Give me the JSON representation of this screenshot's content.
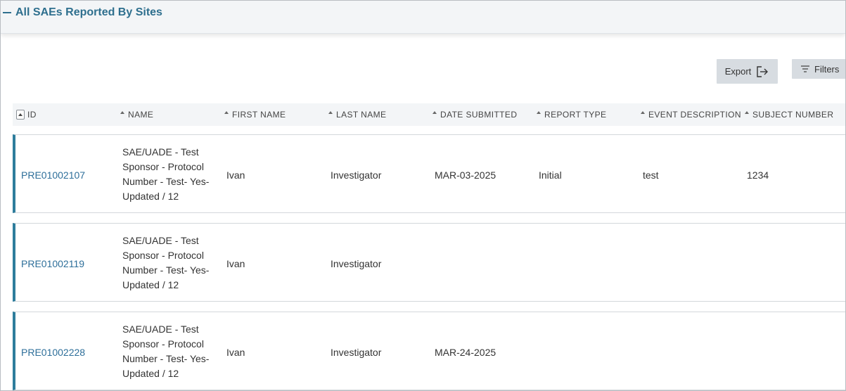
{
  "section": {
    "title": "All SAEs Reported By Sites"
  },
  "toolbar": {
    "export_label": "Export",
    "filters_label": "Filters"
  },
  "table": {
    "columns": [
      "ID",
      "NAME",
      "FIRST NAME",
      "LAST NAME",
      "DATE SUBMITTED",
      "REPORT TYPE",
      "EVENT DESCRIPTION",
      "SUBJECT NUMBER"
    ],
    "rows": [
      {
        "id": "PRE01002107",
        "name": "SAE/UADE - Test Sponsor - Protocol Number - Test- Yes- Updated / 12",
        "first_name": "Ivan",
        "last_name": "Investigator",
        "date_submitted": "MAR-03-2025",
        "report_type": "Initial",
        "event_description": "test",
        "subject_number": "1234"
      },
      {
        "id": "PRE01002119",
        "name": "SAE/UADE - Test Sponsor - Protocol Number - Test- Yes- Updated / 12",
        "first_name": "Ivan",
        "last_name": "Investigator",
        "date_submitted": "",
        "report_type": "",
        "event_description": "",
        "subject_number": ""
      },
      {
        "id": "PRE01002228",
        "name": "SAE/UADE - Test Sponsor - Protocol Number - Test- Yes- Updated / 12",
        "first_name": "Ivan",
        "last_name": "Investigator",
        "date_submitted": "MAR-24-2025",
        "report_type": "",
        "event_description": "",
        "subject_number": ""
      }
    ]
  },
  "icons": {
    "collapse": "minus-icon",
    "export": "export-icon",
    "filters": "filter-icon"
  },
  "colors": {
    "accent": "#2e6f8e",
    "row_marker": "#2e7d9c",
    "link": "#2e6f9a",
    "button_bg": "#d7dce1"
  }
}
